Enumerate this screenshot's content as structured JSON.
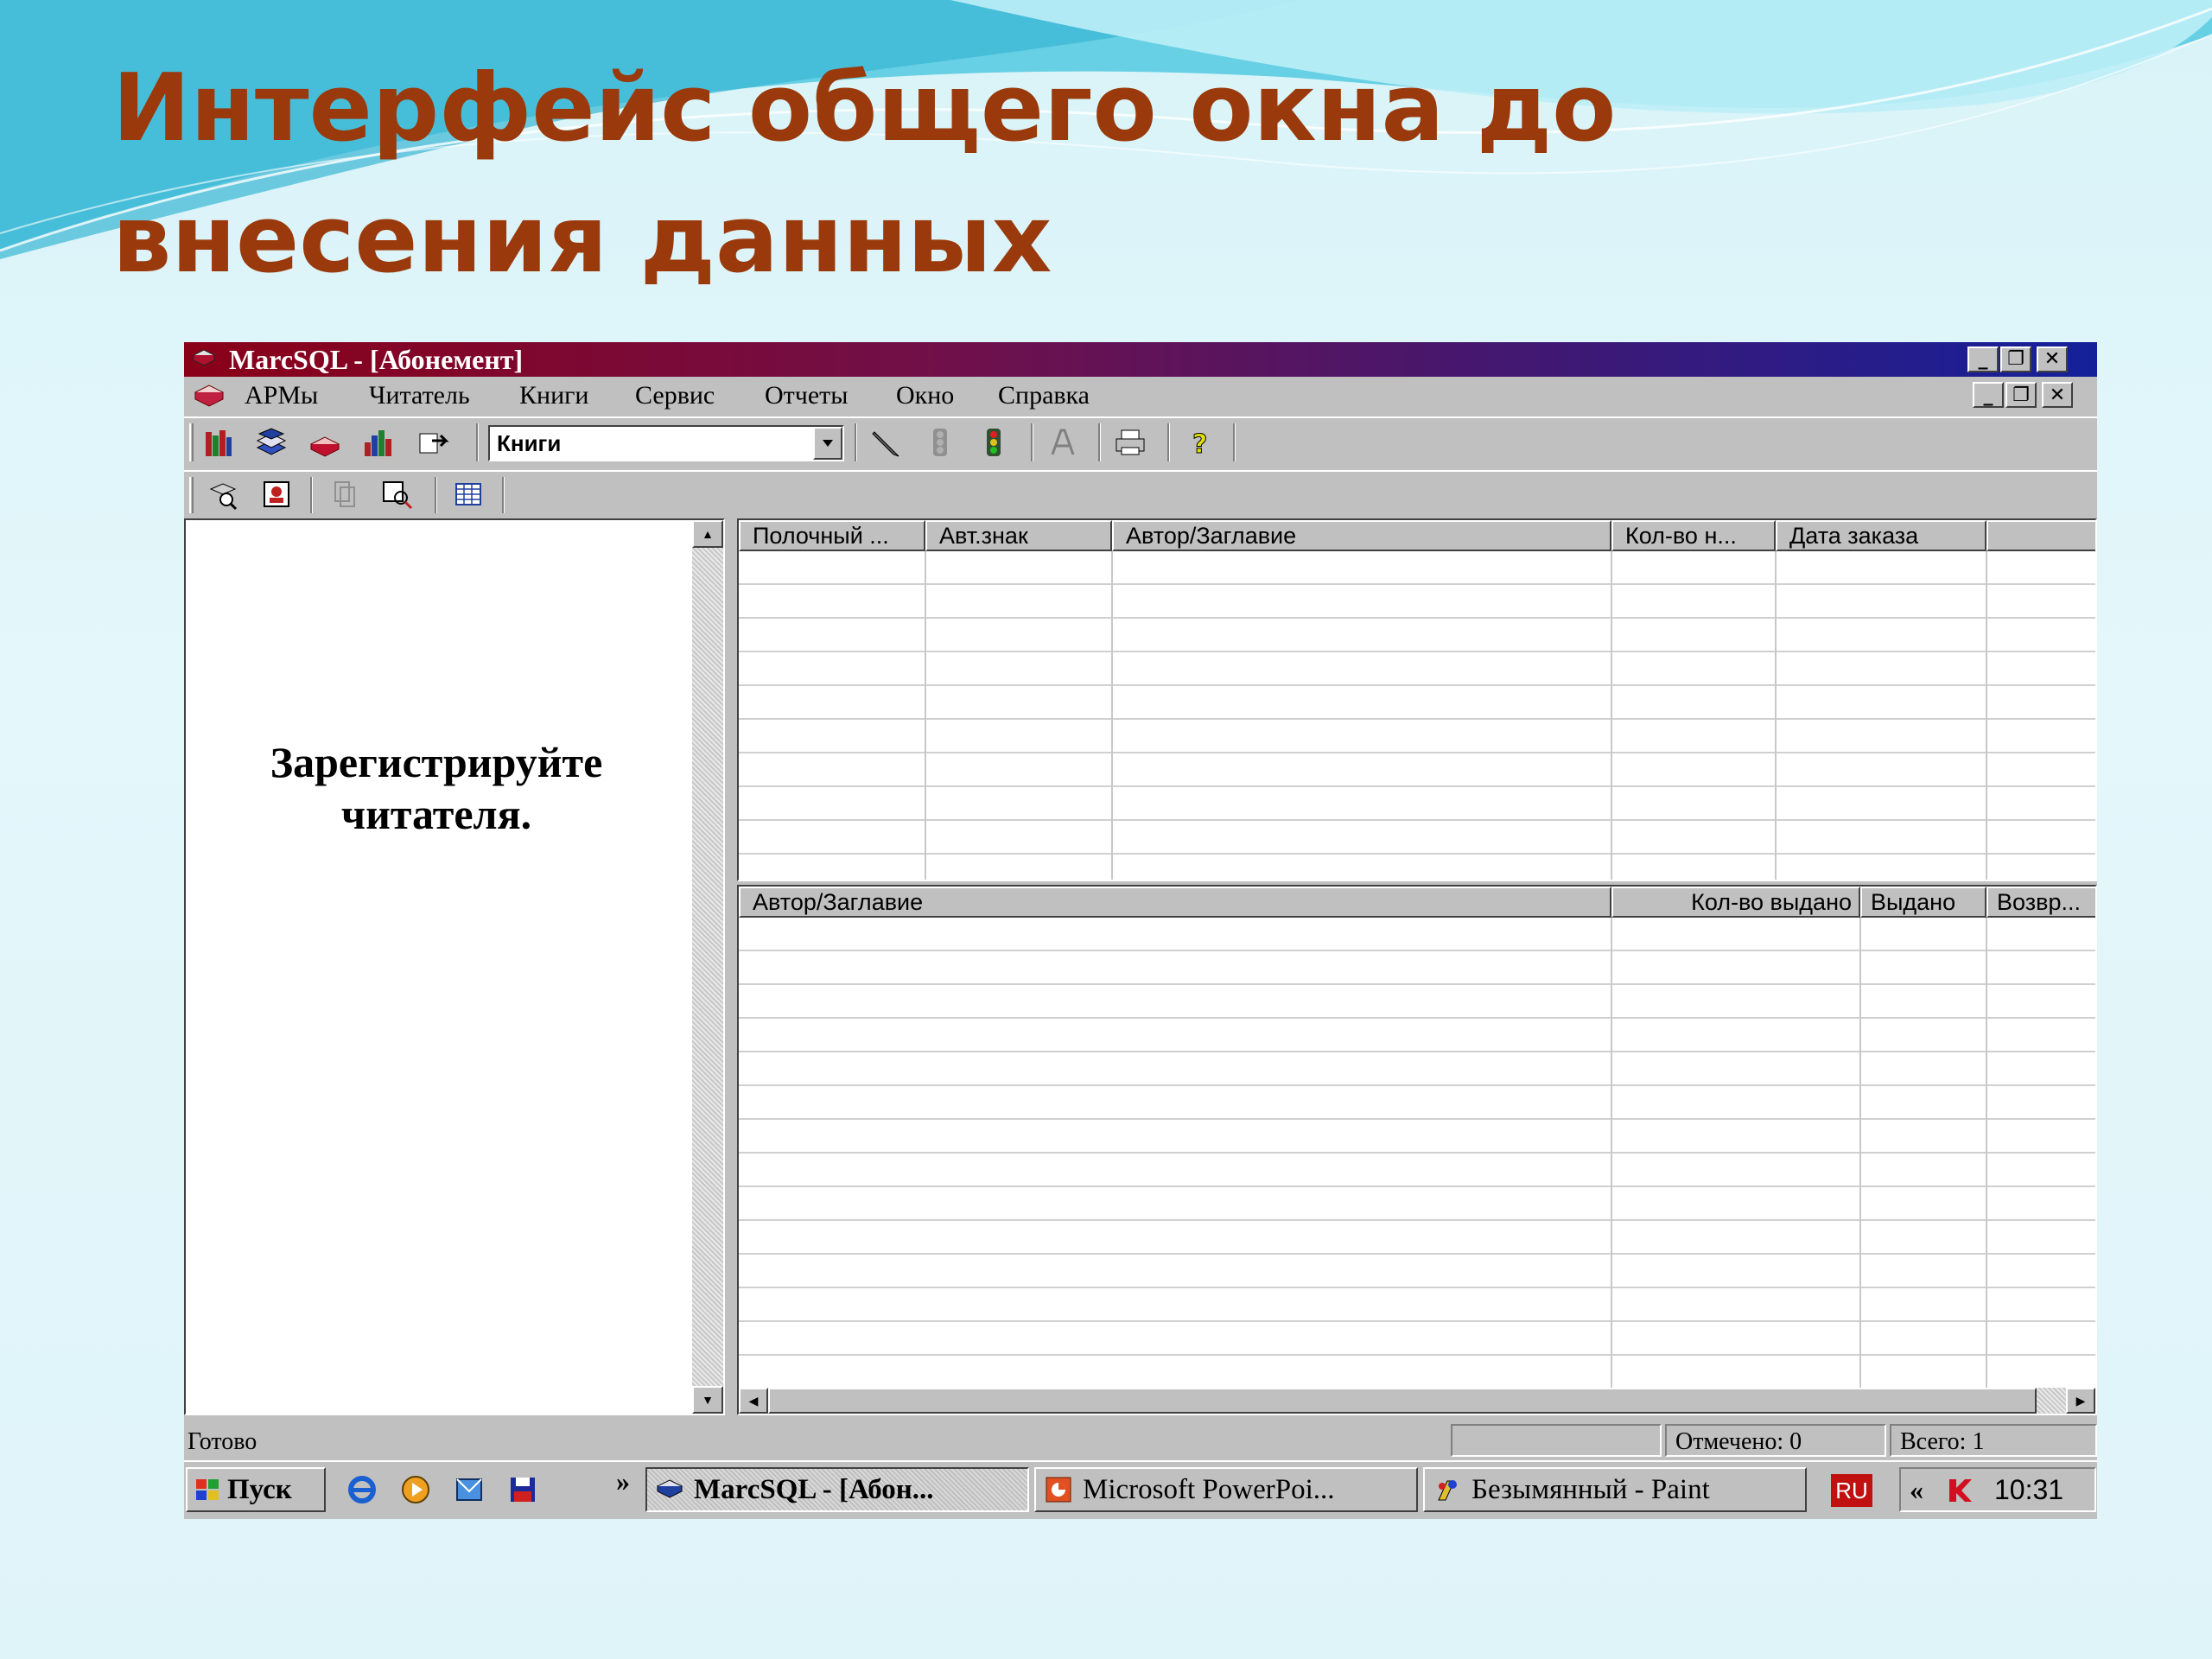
{
  "slide": {
    "title": "Интерфейс общего окна до внесения данных"
  },
  "window": {
    "title": "MarcSQL - [Абонемент]",
    "menu": [
      "АРМы",
      "Читатель",
      "Книги",
      "Сервис",
      "Отчеты",
      "Окно",
      "Справка"
    ],
    "toolbar": {
      "combo_value": "Книги",
      "icons1": [
        "books-icon",
        "stack-icon",
        "book-open-icon",
        "chart-books-icon",
        "send-book-icon"
      ],
      "icons2": [
        "pen-icon",
        "traffic-light-gray-icon",
        "traffic-light-icon",
        "font-icon",
        "print-icon",
        "help-icon"
      ],
      "icons3": [
        "reader-search-icon",
        "reader-card-icon",
        "copy-gray-icon",
        "find-icon",
        "table-icon"
      ]
    },
    "left_pane": {
      "message_line1": "Зарегистрируйте",
      "message_line2": "читателя."
    },
    "orders_grid": {
      "columns": [
        "Полочный ...",
        "Авт.знак",
        "Автор/Заглавие",
        "Кол-во н...",
        "Дата заказа",
        ""
      ],
      "row_count": 9
    },
    "issued_grid": {
      "columns": [
        "Автор/Заглавие",
        "Кол-во выдано",
        "Выдано",
        "Возвр..."
      ],
      "row_count": 14
    },
    "status": {
      "ready": "Готово",
      "marked": "Отмечено: 0",
      "total": "Всего: 1"
    }
  },
  "taskbar": {
    "start": "Пуск",
    "chevron": "»",
    "tasks": [
      "MarcSQL - [Абон...",
      "Microsoft PowerPoi...",
      "Безымянный - Paint"
    ],
    "lang": "RU",
    "tray_chevron": "«",
    "clock": "10:31"
  },
  "colors": {
    "title_text": "#9a3a0c",
    "titlebar_start": "#8a0018",
    "titlebar_end": "#14209a",
    "window_face": "#c0c0c0"
  }
}
